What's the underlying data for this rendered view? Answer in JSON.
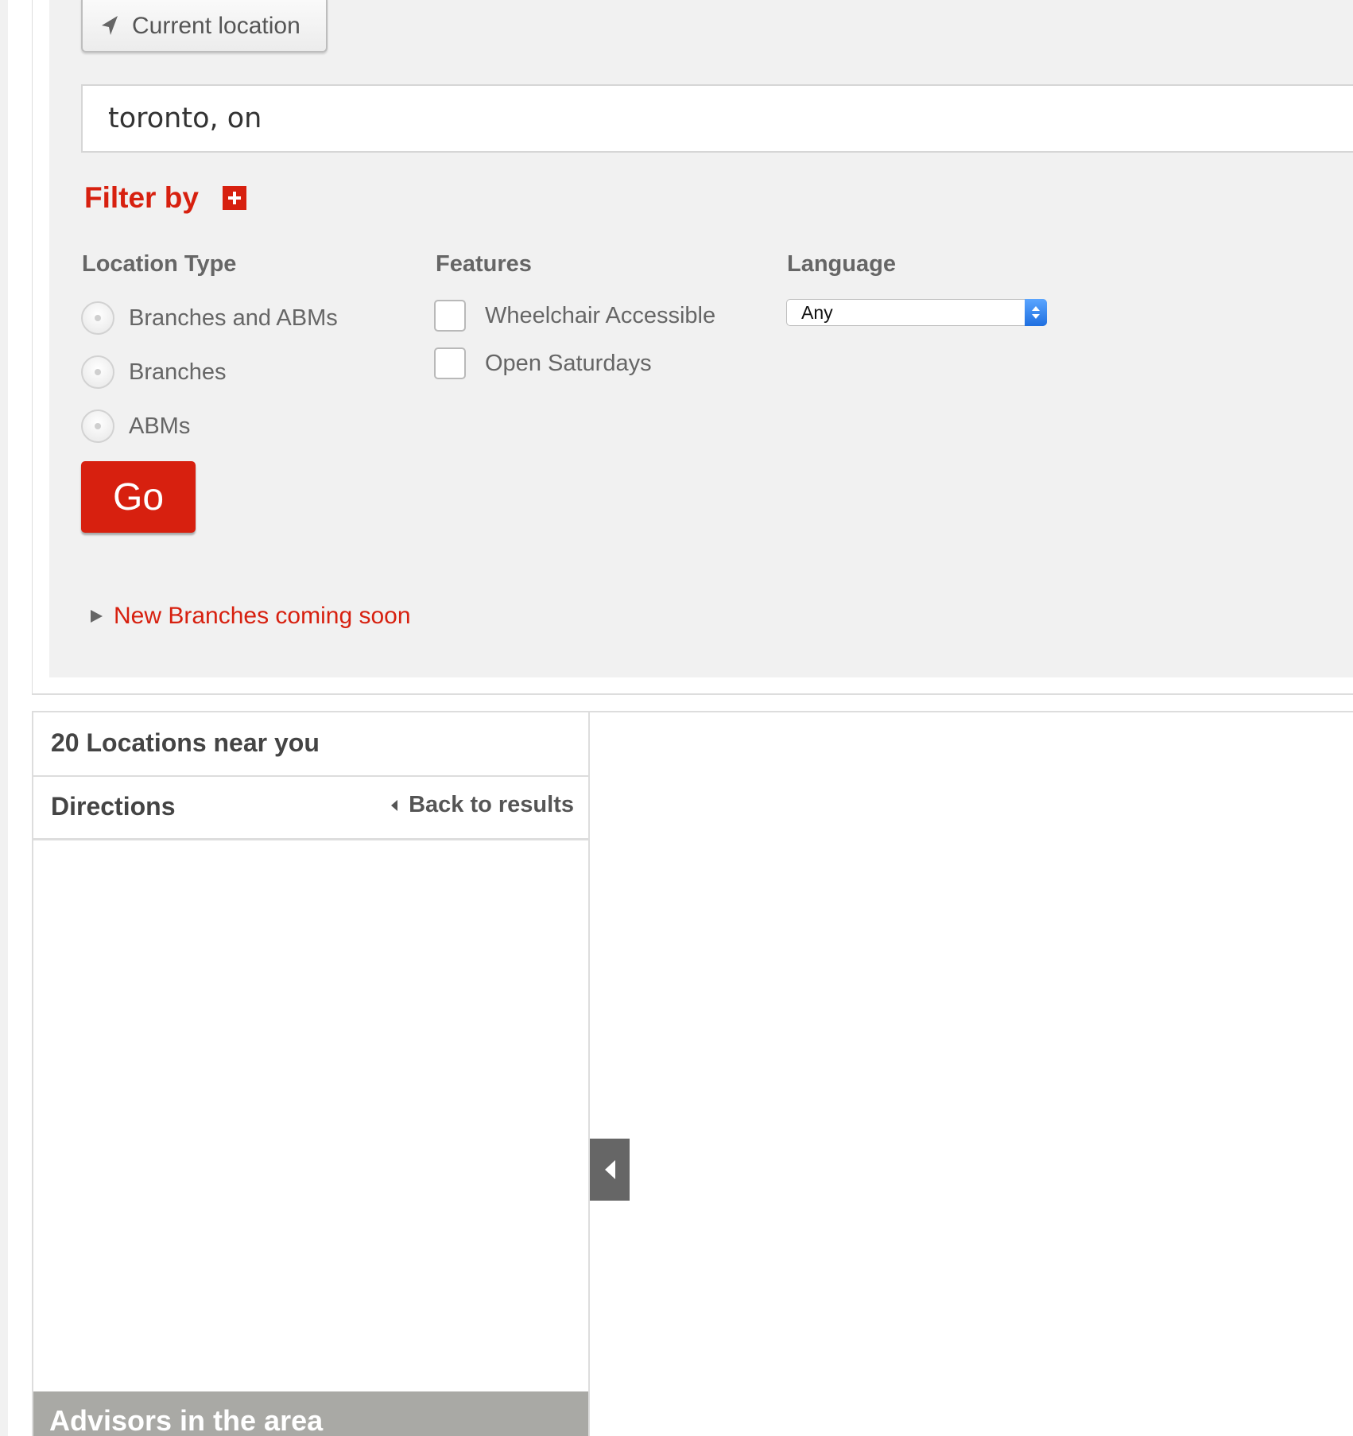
{
  "search": {
    "current_location_label": "Current location",
    "query_value": "toronto, on"
  },
  "filter": {
    "title": "Filter by",
    "location_type": {
      "heading": "Location Type",
      "options": [
        "Branches and ABMs",
        "Branches",
        "ABMs"
      ]
    },
    "features": {
      "heading": "Features",
      "options": [
        "Wheelchair Accessible",
        "Open Saturdays"
      ]
    },
    "language": {
      "heading": "Language",
      "selected": "Any"
    },
    "go_label": "Go",
    "new_branches_label": "New Branches coming soon"
  },
  "results": {
    "count_label": "20 Locations near you",
    "directions_label": "Directions",
    "back_label": "Back to results",
    "advisors_label": "Advisors in the area"
  },
  "colors": {
    "accent": "#d7200f",
    "panel_bg": "#f1f1f1",
    "select_arrow": "#2f80ed"
  }
}
